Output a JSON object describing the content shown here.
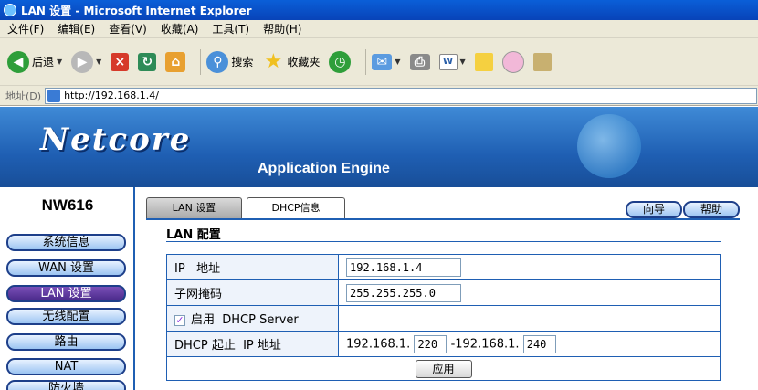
{
  "window": {
    "title": "LAN 设置 - Microsoft Internet Explorer"
  },
  "menu": [
    "文件(F)",
    "编辑(E)",
    "查看(V)",
    "收藏(A)",
    "工具(T)",
    "帮助(H)"
  ],
  "toolbar": {
    "back": "后退",
    "search": "搜索",
    "favorites": "收藏夹"
  },
  "address": {
    "label": "地址(D)",
    "url": "http://192.168.1.4/"
  },
  "banner": {
    "logo": "Netcore",
    "tagline": "Application Engine"
  },
  "sidebar": {
    "model": "NW616",
    "items": [
      "系统信息",
      "WAN 设置",
      "LAN 设置",
      "无线配置",
      "路由",
      "NAT",
      "防火墙"
    ]
  },
  "tabs": [
    "LAN 设置",
    "DHCP信息"
  ],
  "buttons": {
    "wizard": "向导",
    "help": "帮助",
    "apply": "应用"
  },
  "section": {
    "title": "LAN 配置"
  },
  "form": {
    "ip_label": "IP   地址",
    "ip_value": "192.168.1.4",
    "mask_label": "子网掩码",
    "mask_value": "255.255.255.0",
    "dhcp_label": "启用  DHCP Server",
    "dhcp_checked": true,
    "range_label": "DHCP 起止  IP 地址",
    "range_prefix": "192.168.1.",
    "range_start": "220",
    "range_sep": "-192.168.1.",
    "range_end": "240"
  }
}
